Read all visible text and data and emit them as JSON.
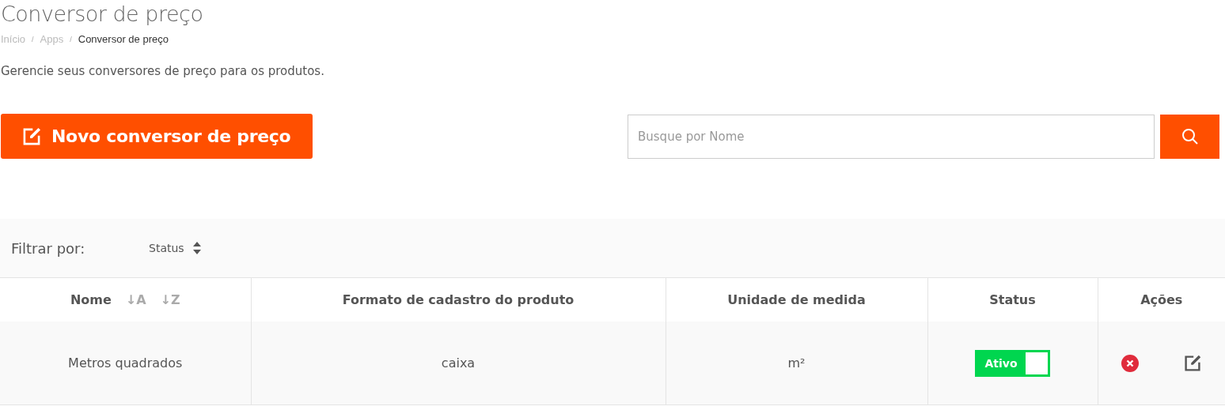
{
  "page": {
    "title": "Conversor de preço",
    "description": "Gerencie seus conversores de preço para os produtos."
  },
  "breadcrumb": [
    {
      "label": "Início",
      "current": false
    },
    {
      "label": "Apps",
      "current": false
    },
    {
      "label": "Conversor de preço",
      "current": true
    }
  ],
  "breadcrumb_separator": "/",
  "new_button": {
    "label": "Novo conversor de preço"
  },
  "search": {
    "placeholder": "Busque por Nome"
  },
  "filter": {
    "label": "Filtrar por:",
    "field": "Status"
  },
  "table": {
    "columns": [
      {
        "label": "Nome",
        "sort_labels": [
          "↓A",
          "↓Z"
        ]
      },
      {
        "label": "Formato de cadastro do produto"
      },
      {
        "label": "Unidade de medida"
      },
      {
        "label": "Status"
      },
      {
        "label": "Ações"
      }
    ],
    "rows": [
      {
        "name": "Metros quadrados",
        "format": "caixa",
        "unit": "m²",
        "status": {
          "label": "Ativo",
          "on": true
        }
      }
    ]
  }
}
